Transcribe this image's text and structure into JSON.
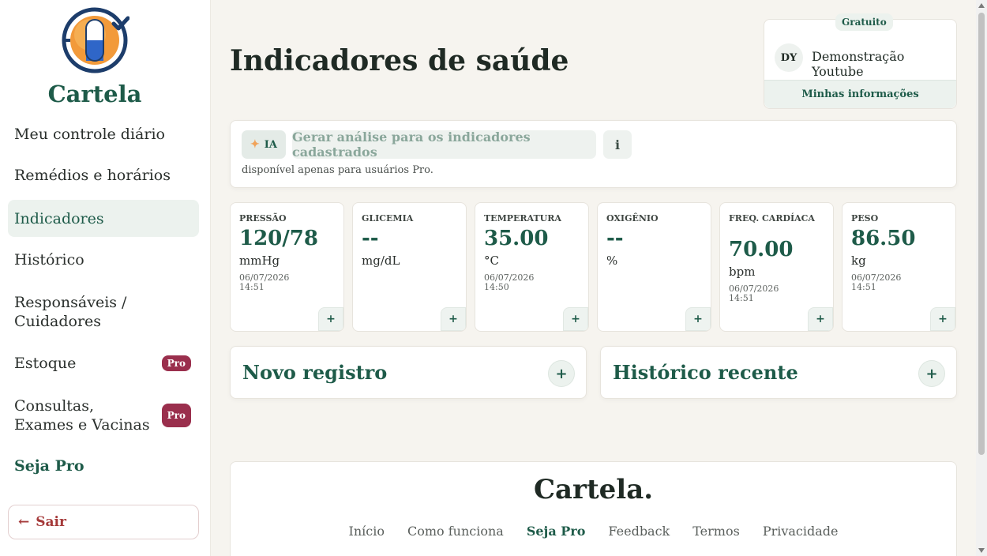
{
  "brand": {
    "name": "Cartela"
  },
  "sidebar": {
    "items": [
      {
        "label": "Meu controle diário"
      },
      {
        "label": "Remédios e horários"
      },
      {
        "label": "Indicadores"
      },
      {
        "label": "Histórico"
      },
      {
        "label": "Responsáveis / Cuidadores"
      },
      {
        "label": "Estoque",
        "badge": "Pro"
      },
      {
        "label": "Consultas, Exames e Vacinas",
        "badge": "Pro"
      },
      {
        "label": "Seja Pro"
      }
    ],
    "logout": {
      "arrow": "←",
      "label": "Sair"
    }
  },
  "page": {
    "title": "Indicadores de saúde"
  },
  "user": {
    "plan": "Gratuito",
    "initials": "DY",
    "name": "Demonstração Youtube",
    "info_link": "Minhas informações"
  },
  "ai": {
    "chip_icon": "sparkle-icon",
    "chip_label": "IA",
    "button_label": "Gerar análise para os indicadores cadastrados",
    "info_label": "i",
    "note": "disponível apenas para usuários Pro."
  },
  "indicators": [
    {
      "label": "PRESSÃO",
      "value": "120/78",
      "unit": "mmHg",
      "date": "06/07/2026",
      "time": "14:51"
    },
    {
      "label": "GLICEMIA",
      "value": "--",
      "unit": "mg/dL",
      "date": "",
      "time": ""
    },
    {
      "label": "TEMPERATURA",
      "value": "35.00",
      "unit": "°C",
      "date": "06/07/2026",
      "time": "14:50"
    },
    {
      "label": "OXIGÊNIO",
      "value": "--",
      "unit": "%",
      "date": "",
      "time": ""
    },
    {
      "label": "FREQ. CARDÍACA",
      "value": "70.00",
      "unit": "bpm",
      "date": "06/07/2026",
      "time": "14:51"
    },
    {
      "label": "PESO",
      "value": "86.50",
      "unit": "kg",
      "date": "06/07/2026",
      "time": "14:51"
    }
  ],
  "add_symbol": "+",
  "actions": [
    {
      "title": "Novo registro"
    },
    {
      "title": "Histórico recente"
    }
  ],
  "footer": {
    "brand": "Cartela.",
    "links": [
      "Início",
      "Como funciona",
      "Seja Pro",
      "Feedback",
      "Termos",
      "Privacidade"
    ]
  },
  "colors": {
    "accent": "#1e5b49",
    "pro_badge": "#9a2f4d",
    "logout": "#a53a3a"
  }
}
